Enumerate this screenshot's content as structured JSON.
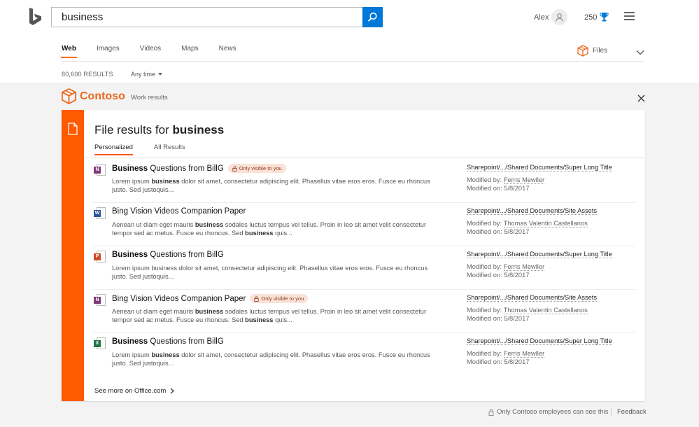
{
  "search": {
    "query": "business"
  },
  "header": {
    "user_name": "Alex",
    "points": "250"
  },
  "nav": {
    "tabs": [
      {
        "label": "Web",
        "active": true
      },
      {
        "label": "Images"
      },
      {
        "label": "Videos"
      },
      {
        "label": "Maps"
      },
      {
        "label": "News"
      }
    ],
    "files_label": "Files"
  },
  "meta": {
    "results_count": "80,600 RESULTS",
    "time_filter": "Any time"
  },
  "org": {
    "name": "Contoso",
    "subtitle": "Work results"
  },
  "card": {
    "title_prefix": "File results for",
    "title_query": "business",
    "subtabs": [
      "Personalized",
      "All Results"
    ],
    "results": [
      {
        "app": "onenote",
        "title_bold": "Business",
        "title_rest": " Questions from BillG",
        "badge": "Only visible to you",
        "snippet_html": "Lorem ipsum <b>business</b> dolor sit amet, consectetur adipiscing elit. Phasellus vitae eros eros. Fusce eu rhoncus justo. Sed justoquis...",
        "path": "Sharepoint/.../Shared Documents/Super Long Title",
        "modified_by_label": "Modified by:",
        "modified_by": "Ferris Mewller",
        "modified_on": "Modified on: 5/8/2017"
      },
      {
        "app": "word",
        "title_bold": "",
        "title_rest": "Bing Vision Videos Companion Paper",
        "badge": "",
        "snippet_html": "Aenean ut diam eget mauris <b>business</b> sodales luctus tempus vel tellus. Proin in leo sit amet velit consectetur tempor sed ac metus. Fusce eu rhoncus. Sed <b>business</b> quis...",
        "path": "Sharepoint/.../Shared Documents/Site Assets",
        "modified_by_label": "Modified by:",
        "modified_by": "Thomas Valentin Castellanos",
        "modified_on": "Modified on: 5/8/2017"
      },
      {
        "app": "powerpoint",
        "title_bold": "Business",
        "title_rest": " Questions from BillG",
        "badge": "",
        "snippet_html": "Lorem ipsum business dolor sit amet, consectetur adipiscing elit. Phasellus vitae eros eros. Fusce eu rhoncus justo. Sed justoquis...",
        "path": "Sharepoint/.../Shared Documents/Super Long Title",
        "modified_by_label": "Modified by:",
        "modified_by": "Ferris Mewller",
        "modified_on": "Modified on: 5/8/2017"
      },
      {
        "app": "onenote",
        "title_bold": "",
        "title_rest": "Bing Vision Videos Companion Paper",
        "badge": "Only visible to you",
        "snippet_html": "Aenean ut diam eget mauris <b>business</b> sodales luctus tempus vel tellus. Proin in leo sit amet velit consectetur tempor sed ac metus. Fusce eu rhoncus. Sed <b>business</b> quis...",
        "path": "Sharepoint/.../Shared Documents/Site Assets",
        "modified_by_label": "Modified by:",
        "modified_by": "Thomas Valentin Castellanos",
        "modified_on": "Modified on: 5/8/2017"
      },
      {
        "app": "excel",
        "title_bold": "Business",
        "title_rest": " Questions from BillG",
        "badge": "",
        "snippet_html": "Lorem ipsum <b>business</b> dolor sit amet, consectetur adipiscing elit. Phasellus vitae eros eros. Fusce eu rhoncus justo. Sed justoquis...",
        "path": "Sharepoint/.../Shared Documents/Super Long Title",
        "modified_by_label": "Modified by:",
        "modified_by": "Ferris Mewller",
        "modified_on": "Modified on: 5/8/2017"
      }
    ],
    "see_more": "See more on Office.com"
  },
  "footer": {
    "note": "Only Contoso employees can see this",
    "feedback": "Feedback"
  },
  "colors": {
    "accent": "#ff5a00",
    "brand_blue": "#0078d7",
    "onenote": "#80397b",
    "word": "#2b579a",
    "powerpoint": "#d24726",
    "excel": "#217346"
  },
  "icons": {
    "logo": "bing-logo-icon",
    "search": "search-icon",
    "avatar": "user-icon",
    "trophy": "trophy-icon",
    "menu": "hamburger-icon",
    "files": "cube-icon",
    "close": "close-icon"
  }
}
